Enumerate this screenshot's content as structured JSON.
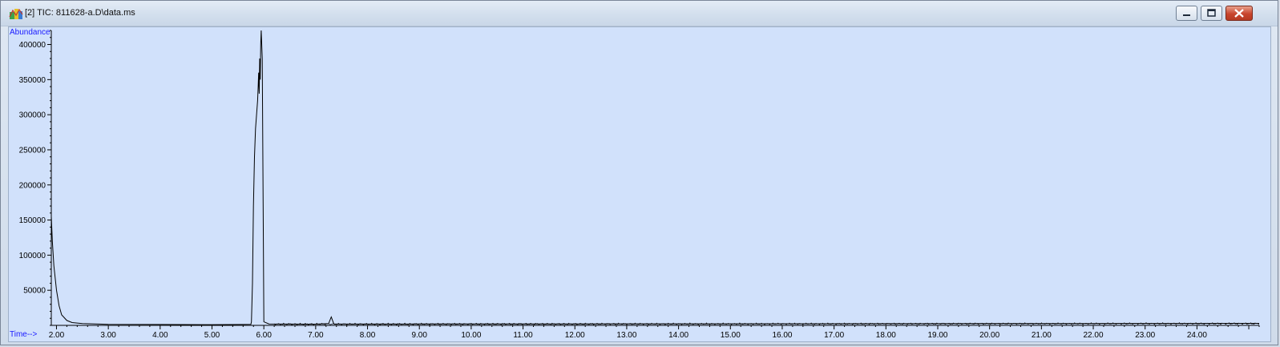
{
  "window": {
    "title": "[2] TIC: 811628-a.D\\data.ms",
    "buttons": [
      "minimize",
      "maximize",
      "close"
    ],
    "icon": "chromatogram-app-icon"
  },
  "chart_data": {
    "type": "line",
    "ylabel": "Abundance",
    "xlabel": "Time-->",
    "xlim": [
      1.9,
      25.2
    ],
    "ylim": [
      0,
      420000
    ],
    "x_ticks": [
      "2.00",
      "3.00",
      "4.00",
      "5.00",
      "6.00",
      "7.00",
      "8.00",
      "9.00",
      "10.00",
      "11.00",
      "12.00",
      "13.00",
      "14.00",
      "15.00",
      "16.00",
      "17.00",
      "18.00",
      "19.00",
      "20.00",
      "21.00",
      "22.00",
      "23.00",
      "24.00"
    ],
    "y_ticks": [
      "50000",
      "100000",
      "150000",
      "200000",
      "250000",
      "300000",
      "350000",
      "400000"
    ],
    "series": [
      {
        "x": [
          1.9,
          1.92,
          1.95,
          2.0,
          2.05,
          2.1,
          2.2,
          2.3,
          2.5,
          3.0,
          4.0,
          5.0,
          5.3,
          5.6,
          5.75,
          5.76,
          5.78,
          5.8,
          5.82,
          5.84,
          5.86,
          5.88,
          5.89,
          5.9,
          5.91,
          5.92,
          5.93,
          5.94,
          5.95,
          5.97,
          6.0,
          6.1,
          6.5,
          7.0,
          7.25,
          7.3,
          7.35,
          8.0,
          9.0,
          10.0,
          12.0,
          14.0,
          16.0,
          18.0,
          20.0,
          22.0,
          24.0,
          25.2
        ],
        "y": [
          155000,
          120000,
          85000,
          50000,
          28000,
          15000,
          7000,
          4000,
          2500,
          1500,
          1200,
          1000,
          1100,
          1200,
          1500,
          5000,
          60000,
          170000,
          240000,
          280000,
          300000,
          320000,
          340000,
          360000,
          330000,
          380000,
          350000,
          400000,
          420000,
          380000,
          5000,
          2000,
          1800,
          1700,
          2500,
          12000,
          2000,
          1800,
          1900,
          2000,
          2100,
          2200,
          2300,
          2400,
          2500,
          2600,
          2700,
          2800
        ]
      }
    ]
  }
}
